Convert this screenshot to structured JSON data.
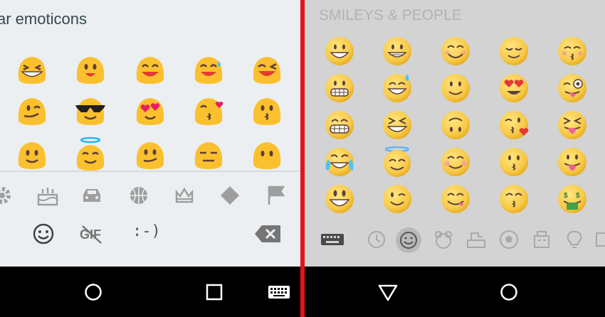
{
  "left_keyboard": {
    "title": "ar emoticons",
    "emoji_grid": [
      [
        "grinning-squint",
        "smile",
        "blush-smile",
        "sweat-smile",
        "laughing-wink"
      ],
      [
        "wink-tongue",
        "sunglasses",
        "heart-eyes",
        "kiss-heart",
        "kissing"
      ],
      [
        "slight-smile",
        "halo",
        "smirk",
        "neutral",
        "blank"
      ]
    ],
    "category_icons": [
      "gear-icon",
      "cake-icon",
      "car-icon",
      "basketball-icon",
      "crown-icon",
      "diamond-icon",
      "flag-icon"
    ],
    "bottom_icons": [
      "smiley-icon",
      "no-gif-icon",
      "backspace-icon"
    ],
    "text_emoticon": ":-)",
    "colors": {
      "background": "#eceff1",
      "emoji": "#fbc02d",
      "icon": "#9e9e9e"
    }
  },
  "right_keyboard": {
    "title": "SMILEYS & PEOPLE",
    "emoji_grid": [
      [
        "grinning",
        "grin",
        "smile-blush",
        "relieved",
        "kissing-closed-eyes"
      ],
      [
        "grimacing",
        "sweat-smile",
        "slight-smile",
        "heart-eyes",
        "wink-tongue"
      ],
      [
        "grin-teeth",
        "laughing",
        "upside-down",
        "kiss-heart",
        "squint-tongue"
      ],
      [
        "tears-of-joy",
        "innocent",
        "blushing",
        "kissing",
        "tongue"
      ],
      [
        "grinning-big",
        "winking",
        "yum",
        "kissing-smiling",
        "money-mouth"
      ]
    ],
    "category_icons": [
      "keyboard-icon",
      "clock-icon",
      "smiley-icon",
      "bear-icon",
      "food-icon",
      "soccer-icon",
      "building-icon",
      "bulb-icon",
      "symbols-icon"
    ],
    "selected_category": "smiley-icon",
    "colors": {
      "background": "#d3d3d3",
      "emoji": "#f7c948",
      "title": "#b3b3b3"
    }
  },
  "navigation_bars": {
    "left": [
      "home-button",
      "recents-button",
      "keyboard-switch-button"
    ],
    "right": [
      "back-button",
      "home-button"
    ]
  },
  "divider_color": "#e3141b"
}
